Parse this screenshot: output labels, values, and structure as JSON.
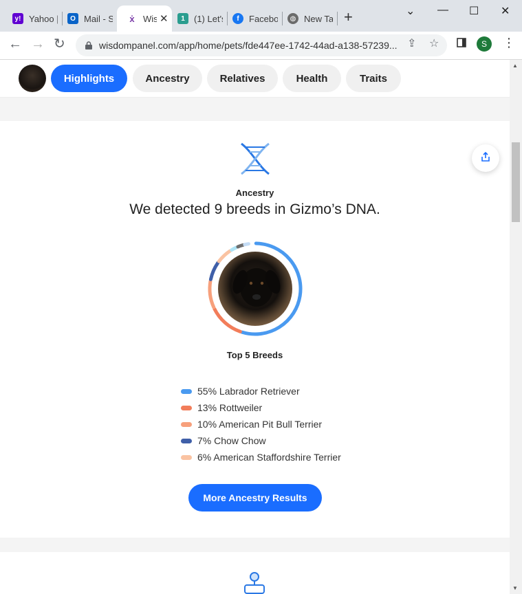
{
  "browser": {
    "tabs": [
      {
        "label": "Yahoo |",
        "icon": "yahoo-icon"
      },
      {
        "label": "Mail - S",
        "icon": "outlook-icon"
      },
      {
        "label": "Wis",
        "icon": "wisdom-icon",
        "active": true
      },
      {
        "label": "(1) Let's",
        "icon": "tab-icon"
      },
      {
        "label": "Faceboo",
        "icon": "facebook-icon"
      },
      {
        "label": "New Ta",
        "icon": "globe-icon"
      }
    ],
    "url": "wisdompanel.com/app/home/pets/fde447ee-1742-44ad-a138-57239...",
    "profile_initial": "S"
  },
  "subnav": {
    "tabs": [
      "Highlights",
      "Ancestry",
      "Relatives",
      "Health",
      "Traits"
    ],
    "active": "Highlights"
  },
  "ancestry": {
    "section_label": "Ancestry",
    "headline": "We detected 9 breeds in Gizmo’s DNA.",
    "top_label": "Top 5 Breeds",
    "breeds": [
      {
        "label": "55% Labrador Retriever",
        "percent": 55,
        "color": "#4a9af0"
      },
      {
        "label": "13% Rottweiler",
        "percent": 13,
        "color": "#f27d5a"
      },
      {
        "label": "10% American Pit Bull Terrier",
        "percent": 10,
        "color": "#f7a07c"
      },
      {
        "label": "7% Chow Chow",
        "percent": 7,
        "color": "#3f5fa8"
      },
      {
        "label": "6% American Staffordshire Terrier",
        "percent": 6,
        "color": "#fac3a2"
      }
    ],
    "button_label": "More Ancestry Results"
  }
}
